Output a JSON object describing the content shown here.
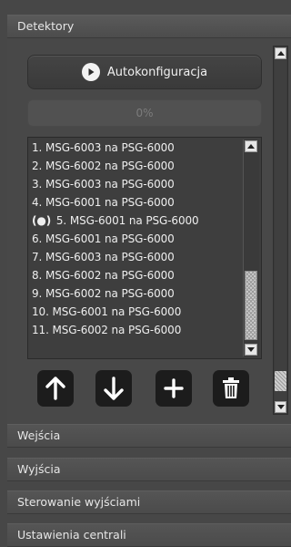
{
  "sections": {
    "detektory": "Detektory",
    "wejscia": "Wejścia",
    "wyjscia": "Wyjścia",
    "sterowanie": "Sterowanie wyjściami",
    "ustawienia": "Ustawienia centrali"
  },
  "autoconfig": {
    "label": "Autokonfiguracja",
    "icon": "play-icon"
  },
  "progress": {
    "text": "0%",
    "value": 0
  },
  "detector_list": {
    "items": [
      {
        "text": "1. MSG-6003 na PSG-6000",
        "selected": false
      },
      {
        "text": "2. MSG-6002 na PSG-6000",
        "selected": false
      },
      {
        "text": "3. MSG-6003 na PSG-6000",
        "selected": false
      },
      {
        "text": "4. MSG-6001 na PSG-6000",
        "selected": false
      },
      {
        "text": "5. MSG-6001 na PSG-6000",
        "selected": true,
        "marker": "(●)"
      },
      {
        "text": "6. MSG-6001 na PSG-6000",
        "selected": false
      },
      {
        "text": "7. MSG-6003 na PSG-6000",
        "selected": false
      },
      {
        "text": "8. MSG-6002 na PSG-6000",
        "selected": false
      },
      {
        "text": "9. MSG-6002 na PSG-6000",
        "selected": false
      },
      {
        "text": "10. MSG-6001 na PSG-6000",
        "selected": false
      },
      {
        "text": "11. MSG-6002 na PSG-6000",
        "selected": false
      }
    ]
  },
  "actions": {
    "move_up": "arrow-up-icon",
    "move_down": "arrow-down-icon",
    "add": "plus-icon",
    "delete": "trash-icon"
  },
  "colors": {
    "background": "#474747",
    "header": "#505050",
    "list_background": "#3e3e3e",
    "button_dark": "#1c1c1c"
  }
}
